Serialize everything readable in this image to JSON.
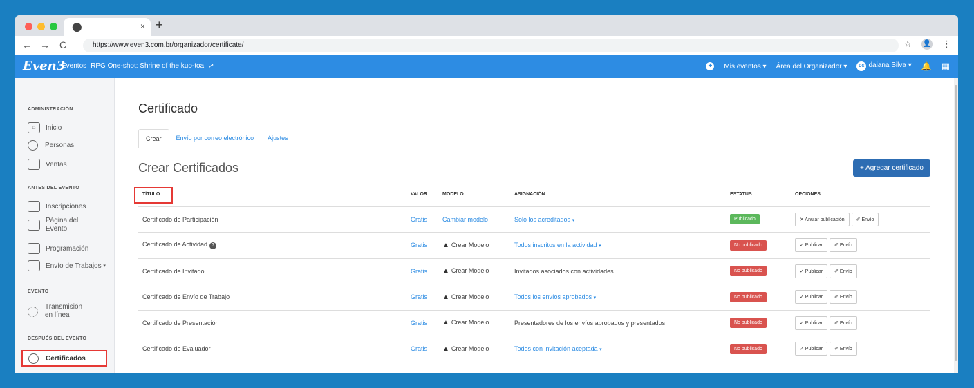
{
  "browser": {
    "tab_favicon": "⬤",
    "tab_close": "×",
    "new_tab": "+",
    "back": "←",
    "forward": "→",
    "reload": "C",
    "url": "https://www.even3.com.br/organizador/certificate/",
    "star": "☆",
    "profile": "👤",
    "menu": "⋮"
  },
  "header": {
    "logo": "Even3",
    "nav_events": "Eventos",
    "event_name": "RPG One-shot: Shrine of the kuo-toa",
    "ext_icon": "↗",
    "plus": "+",
    "my_events": "Mis eventos",
    "organizer_area": "Área del Organizador",
    "avatar_initials": "DS",
    "user_name": "daiana Silva",
    "caret": "▾",
    "bell": "🔔",
    "grid": "▦"
  },
  "sidebar": {
    "sections": {
      "admin": "ADMINISTRACIÓN",
      "before": "ANTES DEL EVENTO",
      "event": "EVENTO",
      "after": "DESPUÉS DEL EVENTO"
    },
    "items": {
      "inicio": "Inicio",
      "personas": "Personas",
      "ventas": "Ventas",
      "inscripciones": "Inscripciones",
      "pagina_line1": "Página del",
      "pagina_line2": "Evento",
      "programacion": "Programación",
      "envio_trabajos": "Envío de Trabajos",
      "transmision_line1": "Transmisión",
      "transmision_line2": "en línea",
      "certificados": "Certificados"
    }
  },
  "main": {
    "page_title": "Certificado",
    "tabs": [
      "Crear",
      "Envío por correo electrónico",
      "Ajustes"
    ],
    "section_heading": "Crear Certificados",
    "add_button": "+ Agregar certificado",
    "columns": [
      "TÍTULO",
      "VALOR",
      "MODELO",
      "ASIGNACIÓN",
      "ESTATUS",
      "OPCIONES"
    ],
    "rows": [
      {
        "title": "Certificado de Participación",
        "value": "Gratis",
        "model": "Cambiar modelo",
        "assignment": "Solo los acreditados",
        "status": "Publicado",
        "opt1": "✕ Anular publicación",
        "opt2": "✐ Envío"
      },
      {
        "title": "Certificado de Actividad",
        "value": "Gratis",
        "model": "Crear Modelo",
        "assignment": "Todos inscritos en la actividad",
        "status": "No publicado",
        "opt1": "✓ Publicar",
        "opt2": "✐ Envío"
      },
      {
        "title": "Certificado de Invitado",
        "value": "Gratis",
        "model": "Crear Modelo",
        "assignment": "Invitados asociados con actividades",
        "status": "No publicado",
        "opt1": "✓ Publicar",
        "opt2": "✐ Envío"
      },
      {
        "title": "Certificado de Envío de Trabajo",
        "value": "Gratis",
        "model": "Crear Modelo",
        "assignment": "Todos los envíos aprobados",
        "status": "No publicado",
        "opt1": "✓ Publicar",
        "opt2": "✐ Envío"
      },
      {
        "title": "Certificado de Presentación",
        "value": "Gratis",
        "model": "Crear Modelo",
        "assignment": "Presentadores de los envíos aprobados y presentados",
        "status": "No publicado",
        "opt1": "✓ Publicar",
        "opt2": "✐ Envío"
      },
      {
        "title": "Certificado de Evaluador",
        "value": "Gratis",
        "model": "Crear Modelo",
        "assignment": "Todos con invitación aceptada",
        "status": "No publicado",
        "opt1": "✓ Publicar",
        "opt2": "✐ Envío"
      }
    ],
    "warn_icon": "▲",
    "info_icon": "?",
    "caret": "▾"
  }
}
